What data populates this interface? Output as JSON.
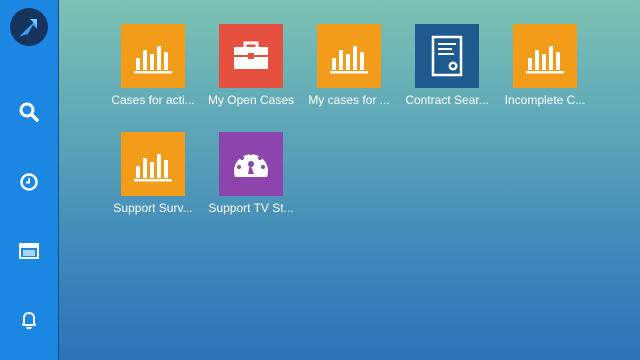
{
  "sidebar": {
    "logo_icon": "launcher-arrow-icon",
    "items": [
      {
        "icon": "search-icon"
      },
      {
        "icon": "clock-icon"
      },
      {
        "icon": "window-icon"
      },
      {
        "icon": "bell-icon"
      }
    ]
  },
  "tiles": [
    {
      "label": "Cases for acti...",
      "icon": "bar-chart-icon",
      "color": "#f39c1a"
    },
    {
      "label": "My Open Cases",
      "icon": "briefcase-icon",
      "color": "#e6513f"
    },
    {
      "label": "My cases for ...",
      "icon": "bar-chart-icon",
      "color": "#f39c1a"
    },
    {
      "label": "Contract Sear...",
      "icon": "certificate-icon",
      "color": "#1e5a8d"
    },
    {
      "label": "Incomplete C...",
      "icon": "bar-chart-icon",
      "color": "#f39c1a"
    },
    {
      "label": "Support Surv...",
      "icon": "bar-chart-icon",
      "color": "#f39c1a"
    },
    {
      "label": "Support TV St...",
      "icon": "dashboard-gauge-icon",
      "color": "#8e44ad"
    }
  ]
}
